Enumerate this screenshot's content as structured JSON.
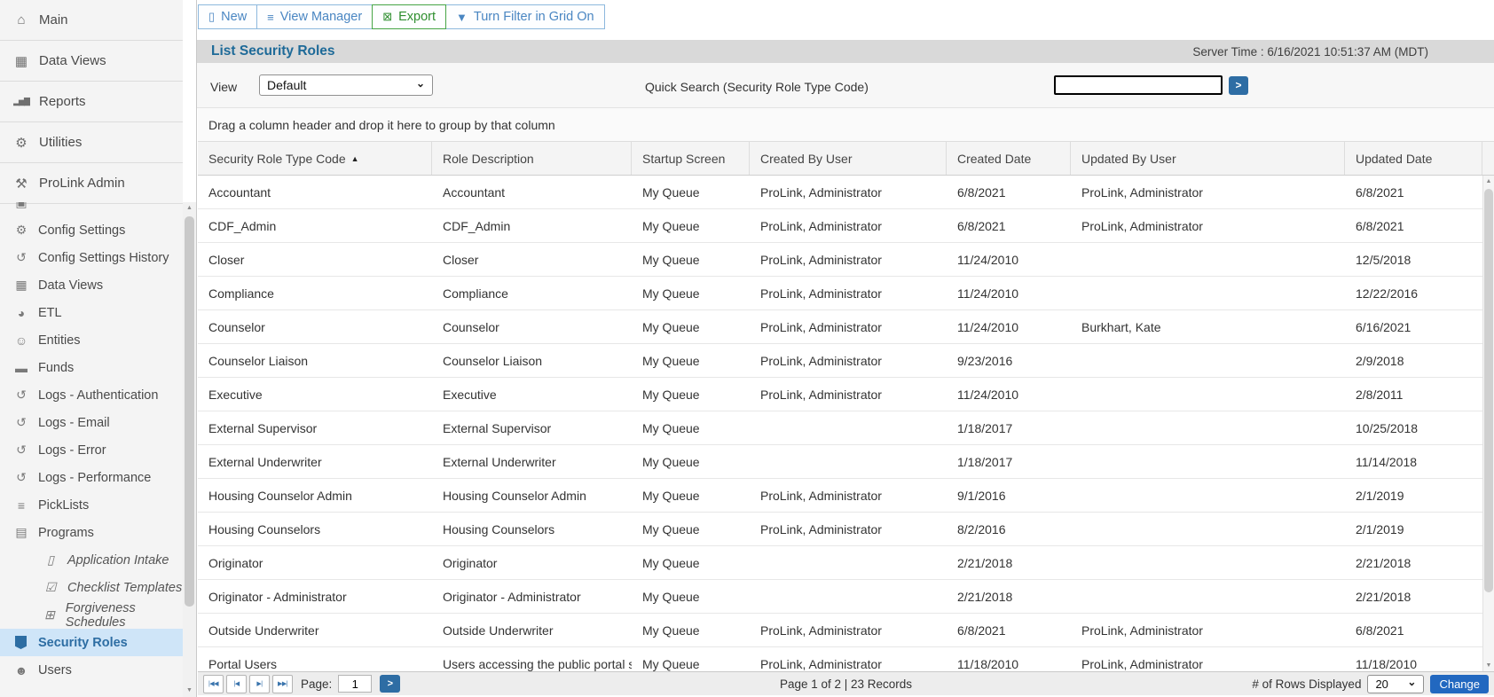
{
  "page": {
    "title": "List Security Roles",
    "server_time": "Server Time : 6/16/2021 10:51:37 AM (MDT)",
    "group_hint": "Drag a column header and drop it here to group by that column"
  },
  "colors": {
    "accent_blue": "#4a86c2",
    "export_green": "#2f8f2f",
    "title_text": "#1e6a98",
    "selected_item_bg": "#cfe5f8",
    "selected_item_text": "#2d6da3",
    "button_blue": "#2e6da4",
    "change_button_blue": "#2268c0",
    "title_bar_bg": "#d9d9d9"
  },
  "sidebar": {
    "main_items": [
      {
        "name": "sidebar-item-main",
        "icon_name": "home-icon",
        "glyph": "⌂",
        "label": "Main"
      },
      {
        "name": "sidebar-item-data-views",
        "icon_name": "table-icon",
        "glyph": "▦",
        "label": "Data Views"
      },
      {
        "name": "sidebar-item-reports",
        "icon_name": "bar-chart-icon",
        "glyph": "▂▅▇",
        "label": "Reports"
      },
      {
        "name": "sidebar-item-utilities",
        "icon_name": "gears-icon",
        "glyph": "⚙",
        "label": "Utilities"
      },
      {
        "name": "sidebar-item-prolink-admin",
        "icon_name": "wrench-icon",
        "glyph": "⚒",
        "label": "ProLink Admin"
      }
    ],
    "admin_items": [
      {
        "name": "sidebar-item-clipped",
        "icon_name": "clipped-icon",
        "glyph": "▣",
        "label": "",
        "cls": "cut"
      },
      {
        "name": "sidebar-item-config-settings",
        "icon_name": "gears-icon",
        "glyph": "⚙",
        "label": "Config Settings"
      },
      {
        "name": "sidebar-item-config-settings-history",
        "icon_name": "history-icon",
        "glyph": "↺",
        "label": "Config Settings History"
      },
      {
        "name": "sidebar-item-data-views-admin",
        "icon_name": "table-icon",
        "glyph": "▦",
        "label": "Data Views"
      },
      {
        "name": "sidebar-item-etl",
        "icon_name": "pie-chart-icon",
        "glyph": "◕",
        "label": "ETL"
      },
      {
        "name": "sidebar-item-entities",
        "icon_name": "person-icon",
        "glyph": "☺",
        "label": "Entities"
      },
      {
        "name": "sidebar-item-funds",
        "icon_name": "money-icon",
        "glyph": "▬",
        "label": "Funds"
      },
      {
        "name": "sidebar-item-logs-authentication",
        "icon_name": "history-icon",
        "glyph": "↺",
        "label": "Logs - Authentication"
      },
      {
        "name": "sidebar-item-logs-email",
        "icon_name": "history-icon",
        "glyph": "↺",
        "label": "Logs - Email"
      },
      {
        "name": "sidebar-item-logs-error",
        "icon_name": "history-icon",
        "glyph": "↺",
        "label": "Logs - Error"
      },
      {
        "name": "sidebar-item-logs-performance",
        "icon_name": "history-icon",
        "glyph": "↺",
        "label": "Logs - Performance"
      },
      {
        "name": "sidebar-item-picklists",
        "icon_name": "sliders-icon",
        "glyph": "≡",
        "label": "PickLists"
      },
      {
        "name": "sidebar-item-programs",
        "icon_name": "briefcase-icon",
        "glyph": "▤",
        "label": "Programs"
      },
      {
        "name": "sidebar-item-application-intake",
        "icon_name": "file-icon",
        "glyph": "▯",
        "label": "Application Intake",
        "cls": "indent"
      },
      {
        "name": "sidebar-item-checklist-templates",
        "icon_name": "check-square-icon",
        "glyph": "☑",
        "label": "Checklist Templates",
        "cls": "indent"
      },
      {
        "name": "sidebar-item-forgiveness-schedules",
        "icon_name": "calendar-icon",
        "glyph": "⊞",
        "label": "Forgiveness Schedules",
        "cls": "indent"
      },
      {
        "name": "sidebar-item-security-roles",
        "icon_name": "shield-icon",
        "glyph": "",
        "label": "Security Roles",
        "cls": "selected"
      },
      {
        "name": "sidebar-item-users",
        "icon_name": "users-icon",
        "glyph": "☻",
        "label": "Users"
      }
    ]
  },
  "toolbar": {
    "buttons": [
      {
        "name": "new-button",
        "icon_name": "new-document-icon",
        "glyph": "▯",
        "label": "New"
      },
      {
        "name": "view-manager-button",
        "icon_name": "list-icon",
        "glyph": "≡",
        "label": "View Manager"
      },
      {
        "name": "export-button",
        "icon_name": "excel-export-icon",
        "glyph": "⊠",
        "label": "Export",
        "cls": "green"
      },
      {
        "name": "turn-filter-button",
        "icon_name": "filter-icon",
        "glyph": "▼",
        "label": "Turn Filter in Grid On"
      }
    ]
  },
  "controls": {
    "view_label": "View",
    "view_value": "Default",
    "quick_search_label": "Quick Search (Security Role Type Code)",
    "search_value": "",
    "go_label": ">"
  },
  "grid": {
    "columns": [
      {
        "label": "Security Role Type Code",
        "sort": "▲"
      },
      {
        "label": "Role Description",
        "sort": ""
      },
      {
        "label": "Startup Screen",
        "sort": ""
      },
      {
        "label": "Created By User",
        "sort": ""
      },
      {
        "label": "Created Date",
        "sort": ""
      },
      {
        "label": "Updated By User",
        "sort": ""
      },
      {
        "label": "Updated Date",
        "sort": ""
      }
    ],
    "rows": [
      [
        "Accountant",
        "Accountant",
        "My Queue",
        "ProLink, Administrator",
        "6/8/2021",
        "ProLink, Administrator",
        "6/8/2021"
      ],
      [
        "CDF_Admin",
        "CDF_Admin",
        "My Queue",
        "ProLink, Administrator",
        "6/8/2021",
        "ProLink, Administrator",
        "6/8/2021"
      ],
      [
        "Closer",
        "Closer",
        "My Queue",
        "ProLink, Administrator",
        "11/24/2010",
        "",
        "12/5/2018"
      ],
      [
        "Compliance",
        "Compliance",
        "My Queue",
        "ProLink, Administrator",
        "11/24/2010",
        "",
        "12/22/2016"
      ],
      [
        "Counselor",
        "Counselor",
        "My Queue",
        "ProLink, Administrator",
        "11/24/2010",
        "Burkhart, Kate",
        "6/16/2021"
      ],
      [
        "Counselor Liaison",
        "Counselor Liaison",
        "My Queue",
        "ProLink, Administrator",
        "9/23/2016",
        "",
        "2/9/2018"
      ],
      [
        "Executive",
        "Executive",
        "My Queue",
        "ProLink, Administrator",
        "11/24/2010",
        "",
        "2/8/2011"
      ],
      [
        "External Supervisor",
        "External Supervisor",
        "My Queue",
        "",
        "1/18/2017",
        "",
        "10/25/2018"
      ],
      [
        "External Underwriter",
        "External Underwriter",
        "My Queue",
        "",
        "1/18/2017",
        "",
        "11/14/2018"
      ],
      [
        "Housing Counselor Admin",
        "Housing Counselor Admin",
        "My Queue",
        "ProLink, Administrator",
        "9/1/2016",
        "",
        "2/1/2019"
      ],
      [
        "Housing Counselors",
        "Housing Counselors",
        "My Queue",
        "ProLink, Administrator",
        "8/2/2016",
        "",
        "2/1/2019"
      ],
      [
        "Originator",
        "Originator",
        "My Queue",
        "",
        "2/21/2018",
        "",
        "2/21/2018"
      ],
      [
        "Originator - Administrator",
        "Originator - Administrator",
        "My Queue",
        "",
        "2/21/2018",
        "",
        "2/21/2018"
      ],
      [
        "Outside Underwriter",
        "Outside Underwriter",
        "My Queue",
        "ProLink, Administrator",
        "6/8/2021",
        "ProLink, Administrator",
        "6/8/2021"
      ],
      [
        "Portal Users",
        "Users accessing the public portal site",
        "My Queue",
        "ProLink, Administrator",
        "11/18/2010",
        "ProLink, Administrator",
        "11/18/2010"
      ]
    ]
  },
  "pager": {
    "nav": [
      {
        "name": "first-page-button",
        "glyph": "|◀◀"
      },
      {
        "name": "prev-page-button",
        "glyph": "|◀"
      },
      {
        "name": "next-page-button",
        "glyph": "▶|"
      },
      {
        "name": "last-page-button",
        "glyph": "▶▶|"
      }
    ],
    "page_label": "Page:",
    "page_value": "1",
    "go_label": ">",
    "summary": "Page 1 of 2 | 23 Records",
    "rows_label": "# of Rows Displayed",
    "rows_value": "20",
    "change_label": "Change"
  }
}
